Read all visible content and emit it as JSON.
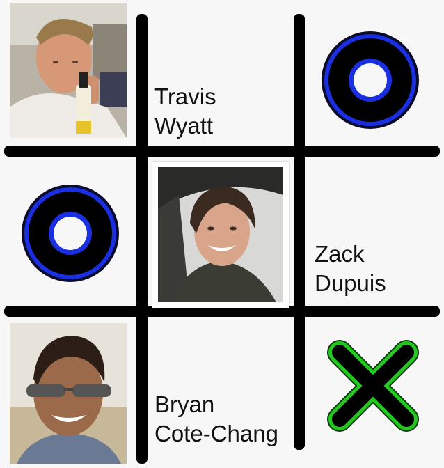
{
  "board": {
    "cells": [
      {
        "row": 0,
        "col": 0,
        "content": "photo",
        "person": "Travis Wyatt"
      },
      {
        "row": 0,
        "col": 1,
        "content": "name",
        "first": "Travis",
        "last": "Wyatt"
      },
      {
        "row": 0,
        "col": 2,
        "content": "mark",
        "mark": "O"
      },
      {
        "row": 1,
        "col": 0,
        "content": "mark",
        "mark": "O"
      },
      {
        "row": 1,
        "col": 1,
        "content": "photo",
        "person": "Zack Dupuis"
      },
      {
        "row": 1,
        "col": 2,
        "content": "name",
        "first": "Zack",
        "last": "Dupuis"
      },
      {
        "row": 2,
        "col": 0,
        "content": "photo",
        "person": "Bryan Cote-Chang"
      },
      {
        "row": 2,
        "col": 1,
        "content": "name",
        "first": "Bryan",
        "last": "Cote-Chang"
      },
      {
        "row": 2,
        "col": 2,
        "content": "mark",
        "mark": "X"
      }
    ]
  },
  "players": {
    "travis": {
      "first": "Travis",
      "last": "Wyatt"
    },
    "zack": {
      "first": "Zack",
      "last": "Dupuis"
    },
    "bryan": {
      "first": "Bryan",
      "last": "Cote-Chang"
    }
  },
  "colors": {
    "grid": "#000000",
    "o_ring": "#1a2fe0",
    "x_glow": "#22c81e",
    "background": "#f8f7f7"
  },
  "icons": {
    "o_mark": "o-mark-icon",
    "x_mark": "x-mark-icon"
  }
}
